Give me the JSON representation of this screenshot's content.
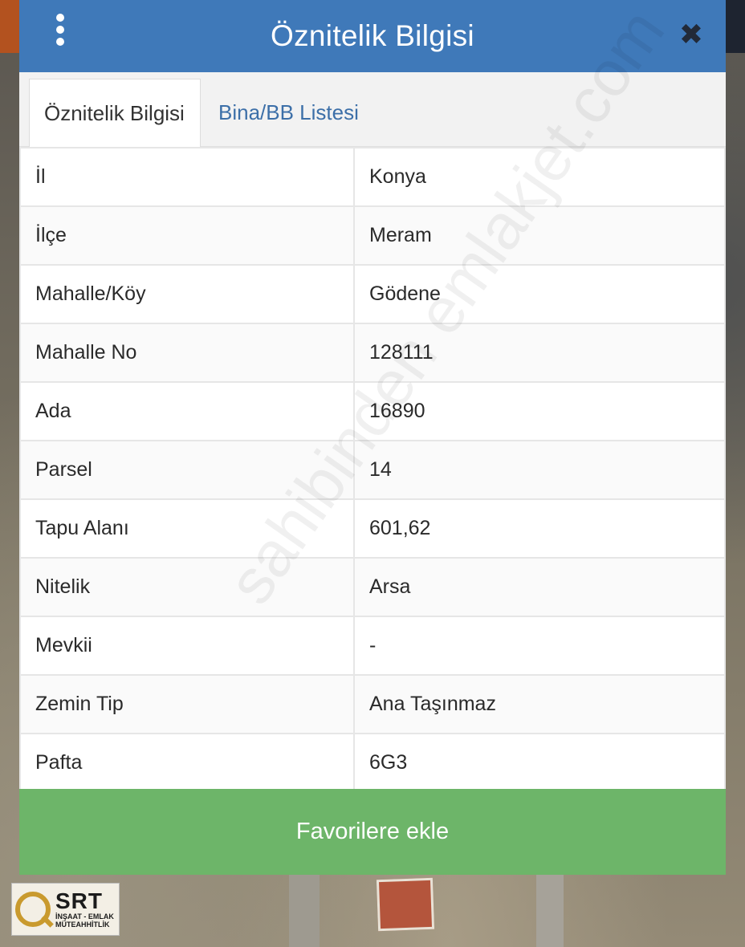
{
  "dialog": {
    "title": "Öznitelik Bilgisi",
    "close_icon": "close-icon",
    "menu_icon": "kebab-menu-icon"
  },
  "tabs": [
    {
      "label": "Öznitelik Bilgisi",
      "active": true
    },
    {
      "label": "Bina/BB Listesi",
      "active": false
    }
  ],
  "attributes": [
    {
      "key": "İl",
      "value": "Konya"
    },
    {
      "key": "İlçe",
      "value": "Meram"
    },
    {
      "key": "Mahalle/Köy",
      "value": "Gödene"
    },
    {
      "key": "Mahalle No",
      "value": "128111"
    },
    {
      "key": "Ada",
      "value": "16890"
    },
    {
      "key": "Parsel",
      "value": "14"
    },
    {
      "key": "Tapu Alanı",
      "value": "601,62"
    },
    {
      "key": "Nitelik",
      "value": "Arsa"
    },
    {
      "key": "Mevkii",
      "value": "-"
    },
    {
      "key": "Zemin Tip",
      "value": "Ana Taşınmaz"
    },
    {
      "key": "Pafta",
      "value": "6G3"
    }
  ],
  "footer": {
    "favorite_label": "Favorilere ekle"
  },
  "watermark": "sahibinden emlakjet.com",
  "logo": {
    "brand": "SRT",
    "line1": "İNŞAAT - EMLAK",
    "line2": "MÜTEAHHİTLİK"
  },
  "colors": {
    "header": "#3f79b9",
    "button": "#6db569",
    "tab_link": "#3c6fa8"
  }
}
